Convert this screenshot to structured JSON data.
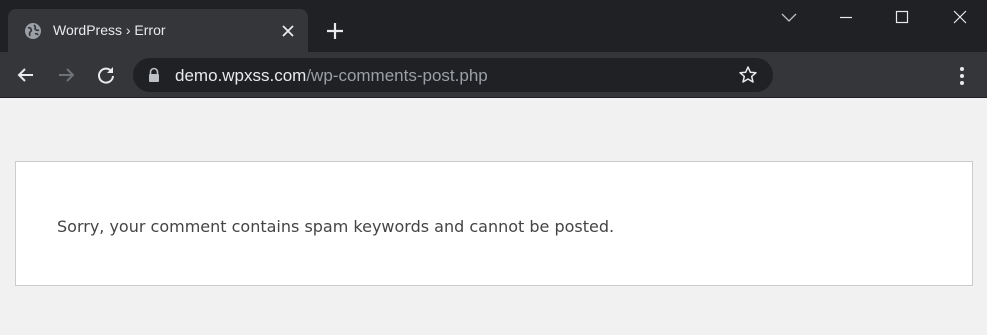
{
  "tab": {
    "title": "WordPress › Error",
    "favicon": "globe-icon",
    "close_icon": "close-icon"
  },
  "new_tab_icon": "plus-icon",
  "window_controls": [
    "chevron-down-icon",
    "minimize-icon",
    "maximize-icon",
    "close-icon"
  ],
  "toolbar": {
    "back_icon": "arrow-left-icon",
    "forward_icon": "arrow-right-icon",
    "reload_icon": "reload-icon",
    "menu_icon": "kebab-menu-icon"
  },
  "omnibox": {
    "lock_icon": "lock-icon",
    "url_host": "demo.wpxss.com",
    "url_path": "/wp-comments-post.php",
    "star_icon": "star-icon"
  },
  "page": {
    "message": "Sorry, your comment contains spam keywords and cannot be posted."
  },
  "colors": {
    "titlebar": "#202124",
    "toolbar": "#35363a",
    "omnibox": "#202124",
    "page_bg": "#f1f1f1",
    "box_bg": "#ffffff",
    "box_border": "#cccccc",
    "message_text": "#444444"
  }
}
